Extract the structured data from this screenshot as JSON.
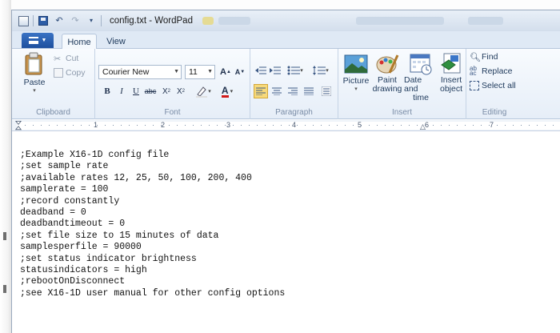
{
  "window": {
    "title": "config.txt - WordPad"
  },
  "tabs": [
    {
      "label": "Home"
    },
    {
      "label": "View"
    }
  ],
  "clipboard": {
    "paste_label": "Paste",
    "cut_label": "Cut",
    "copy_label": "Copy",
    "group_label": "Clipboard"
  },
  "font": {
    "family": "Courier New",
    "size": "11",
    "group_label": "Font"
  },
  "paragraph": {
    "group_label": "Paragraph"
  },
  "insert": {
    "picture_label": "Picture",
    "paint_label_1": "Paint",
    "paint_label_2": "drawing",
    "datetime_label_1": "Date and",
    "datetime_label_2": "time",
    "object_label_1": "Insert",
    "object_label_2": "object",
    "group_label": "Insert"
  },
  "editing": {
    "find_label": "Find",
    "replace_label": "Replace",
    "select_all_label": "Select all",
    "group_label": "Editing"
  },
  "ruler": {
    "numbers": [
      "1",
      "2",
      "3",
      "4",
      "5",
      "6",
      "7"
    ]
  },
  "document": {
    "lines": [
      ";Example X16-1D config file",
      ";set sample rate",
      ";available rates 12, 25, 50, 100, 200, 400",
      "samplerate = 100",
      ";record constantly",
      "deadband = 0",
      "deadbandtimeout = 0",
      ";set file size to 15 minutes of data",
      "samplesperfile = 90000",
      ";set status indicator brightness",
      "statusindicators = high",
      ";rebootOnDisconnect",
      ";see X16-1D user manual for other config options"
    ]
  },
  "colors": {
    "ribbon_text": "#1e395b",
    "file_menu": "#2b62b5",
    "group_label": "#7a8ca6"
  },
  "icons": [
    "app-icon",
    "save-icon",
    "undo-icon",
    "redo-icon",
    "customize-icon",
    "paste-icon",
    "cut-icon",
    "copy-icon",
    "grow-font-icon",
    "shrink-font-icon",
    "bold-icon",
    "italic-icon",
    "underline-icon",
    "strikethrough-icon",
    "subscript-icon",
    "superscript-icon",
    "highlight-icon",
    "font-color-icon",
    "decrease-indent-icon",
    "increase-indent-icon",
    "bullets-icon",
    "line-spacing-icon",
    "align-left-icon",
    "align-center-icon",
    "align-right-icon",
    "justify-icon",
    "paragraph-icon",
    "picture-icon",
    "paint-icon",
    "datetime-icon",
    "object-icon",
    "find-icon",
    "replace-icon",
    "select-all-icon"
  ]
}
